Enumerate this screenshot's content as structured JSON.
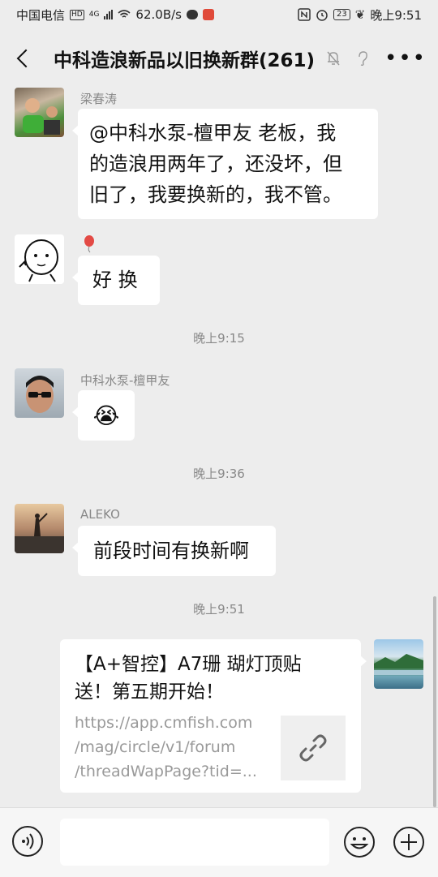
{
  "status_bar": {
    "carrier": "中国电信",
    "hd": "HD",
    "network": "4G",
    "speed": "62.0B/s",
    "battery": "23",
    "time": "晚上9:51"
  },
  "header": {
    "title": "中科造浪新品以旧换新群(261)"
  },
  "messages": [
    {
      "sender": "梁春涛",
      "text_lines": [
        "@中科水泵-檀甲友 老板，我",
        "的造浪用两年了，还没坏，但",
        "旧了，我要换新的，我不管。"
      ]
    },
    {
      "sender": "",
      "text": "好 换"
    },
    {
      "time": "晚上9:15"
    },
    {
      "sender": "中科水泵-檀甲友",
      "emoji": "😭"
    },
    {
      "time": "晚上9:36"
    },
    {
      "sender": "ALEKO",
      "text": "前段时间有换新啊"
    },
    {
      "time": "晚上9:51"
    },
    {
      "link_card": {
        "title_lines": [
          "【A+智控】A7珊 瑚灯顶贴",
          "送！第五期开始！"
        ],
        "url_lines": [
          "https://app.cmfish.com",
          "/mag/circle/v1/forum",
          "/threadWapPage?tid=..."
        ]
      }
    }
  ],
  "colors": {
    "bg": "#ededed",
    "bubble": "#ffffff",
    "meta_text": "#888888"
  }
}
